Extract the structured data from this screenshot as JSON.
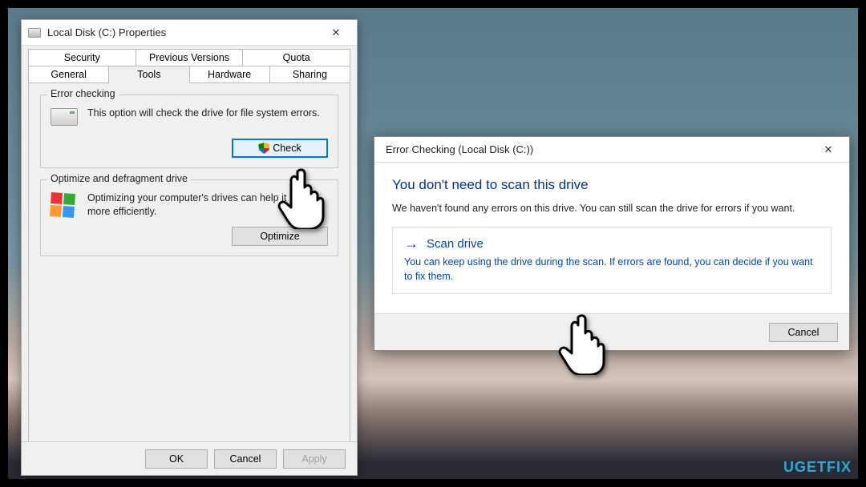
{
  "properties": {
    "title": "Local Disk (C:) Properties",
    "tabs_row1": [
      "Security",
      "Previous Versions",
      "Quota"
    ],
    "tabs_row2": [
      "General",
      "Tools",
      "Hardware",
      "Sharing"
    ],
    "active_tab": "Tools",
    "group_errorcheck": {
      "legend": "Error checking",
      "desc": "This option will check the drive for file system errors.",
      "button": "Check"
    },
    "group_optimize": {
      "legend": "Optimize and defragment drive",
      "desc": "Optimizing your computer's drives can help it run more efficiently.",
      "button": "Optimize"
    },
    "footer": {
      "ok": "OK",
      "cancel": "Cancel",
      "apply": "Apply"
    }
  },
  "error_dialog": {
    "title": "Error Checking (Local Disk (C:))",
    "headline": "You don't need to scan this drive",
    "subtext": "We haven't found any errors on this drive. You can still scan the drive for errors if you want.",
    "option": {
      "title": "Scan drive",
      "desc": "You can keep using the drive during the scan. If errors are found, you can decide if you want to fix them."
    },
    "cancel": "Cancel"
  },
  "watermark": "UGETFIX"
}
